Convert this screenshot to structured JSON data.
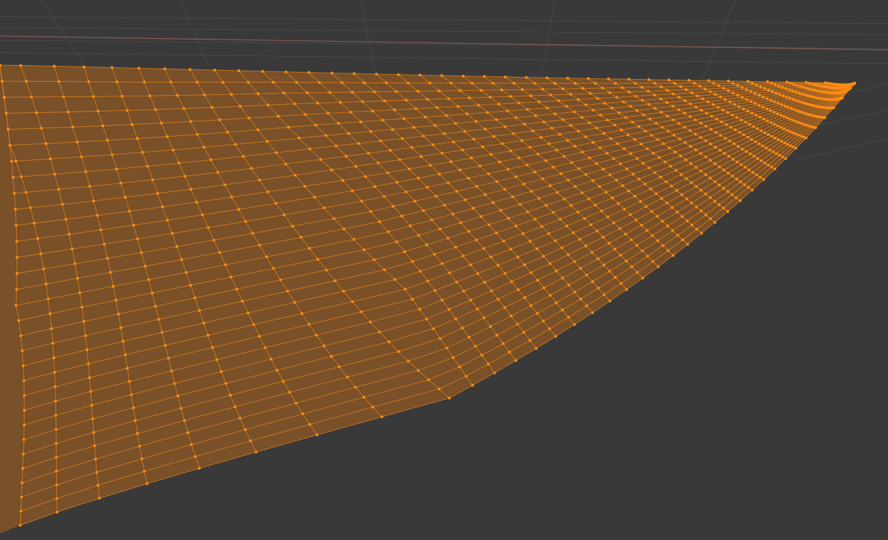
{
  "viewport": {
    "name": "3d-viewport",
    "mode": "edit-mode",
    "background_color": "#393939",
    "grid": {
      "visible": true,
      "line_color": "#4a4a4a",
      "x_axis_color": "#8a5a5a"
    },
    "mesh": {
      "selected": true,
      "face_color": "#7a5128",
      "edge_color": "#f28a1a",
      "vertex_color": "#ff8c12",
      "selection_state": "all-selected"
    }
  }
}
